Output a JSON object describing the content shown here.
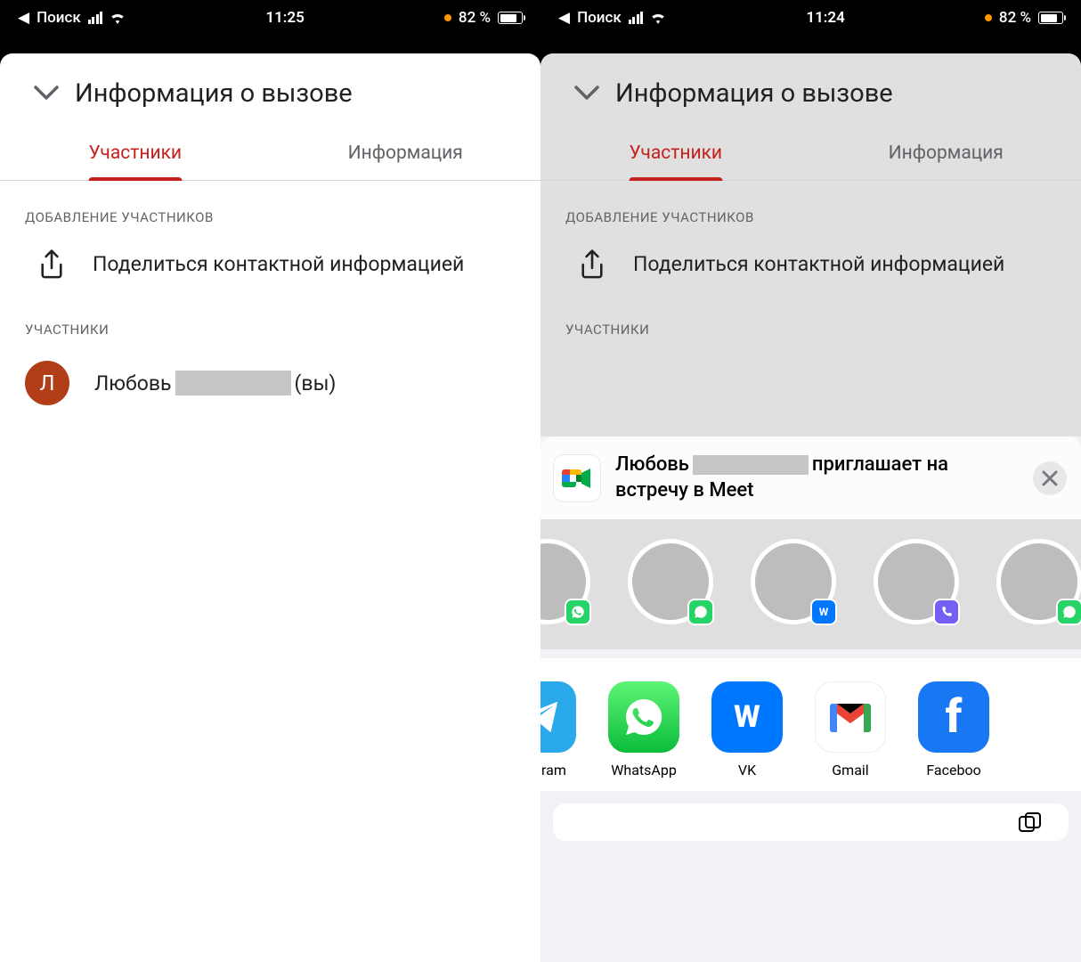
{
  "left": {
    "status": {
      "back_label": "Поиск",
      "time": "11:25",
      "battery_pct": "82 %",
      "battery_fill": 82
    },
    "header_title": "Информация о вызове",
    "tabs": {
      "participants": "Участники",
      "info": "Информация"
    },
    "section_add": "ДОБАВЛЕНИЕ УЧАСТНИКОВ",
    "share_contact": "Поделиться контактной информацией",
    "section_participants": "УЧАСТНИКИ",
    "participant": {
      "initial": "Л",
      "prefix": "Любовь",
      "suffix": "(вы)"
    }
  },
  "right": {
    "status": {
      "back_label": "Поиск",
      "time": "11:24",
      "battery_pct": "82 %",
      "battery_fill": 82
    },
    "header_title": "Информация о вызове",
    "tabs": {
      "participants": "Участники",
      "info": "Информация"
    },
    "section_add": "ДОБАВЛЕНИЕ УЧАСТНИКОВ",
    "share_contact": "Поделиться контактной информацией",
    "section_participants": "УЧАСТНИКИ",
    "share_sheet": {
      "prefix": "Любовь",
      "suffix": "приглашает на встречу в Meet",
      "contacts_badges": [
        "wa",
        "wa",
        "vk",
        "vb",
        "wa"
      ],
      "apps": [
        {
          "id": "telegram",
          "label": "elegram",
          "color": "tg"
        },
        {
          "id": "whatsapp",
          "label": "WhatsApp",
          "color": "wa"
        },
        {
          "id": "vk",
          "label": "VK",
          "color": "vk"
        },
        {
          "id": "gmail",
          "label": "Gmail",
          "color": "gm"
        },
        {
          "id": "facebook",
          "label": "Faceboo",
          "color": "fb"
        }
      ]
    }
  }
}
